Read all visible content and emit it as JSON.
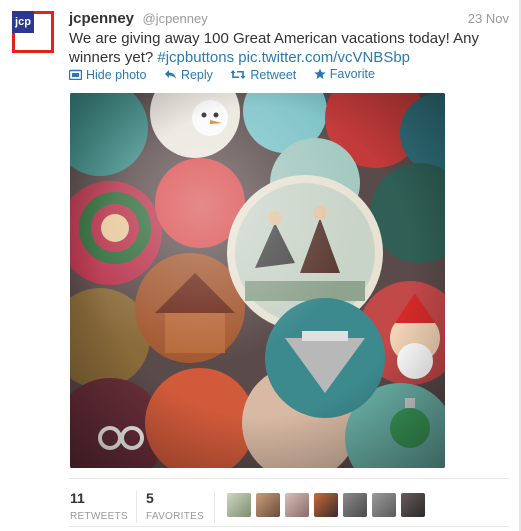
{
  "tweet": {
    "name": "jcpenney",
    "handle": "@jcpenney",
    "date": "23 Nov",
    "text_main": "We are giving away 100 Great American vacations today! Any winners yet? ",
    "hashtag": "#jcpbuttons",
    "link": "pic.twitter.com/vcVNBSbp",
    "logo_text": "jcp"
  },
  "actions": {
    "hide_photo": "Hide photo",
    "reply": "Reply",
    "retweet": "Retweet",
    "favorite": "Favorite"
  },
  "stats": {
    "retweets_count": "11",
    "retweets_label": "RETWEETS",
    "favorites_count": "5",
    "favorites_label": "FAVORITES"
  },
  "colors": {
    "link": "#2a7ab0",
    "brand_red": "#e2231a",
    "brand_blue": "#2b3a8f"
  },
  "icons": [
    "photo-icon",
    "reply-icon",
    "retweet-icon",
    "star-icon"
  ]
}
